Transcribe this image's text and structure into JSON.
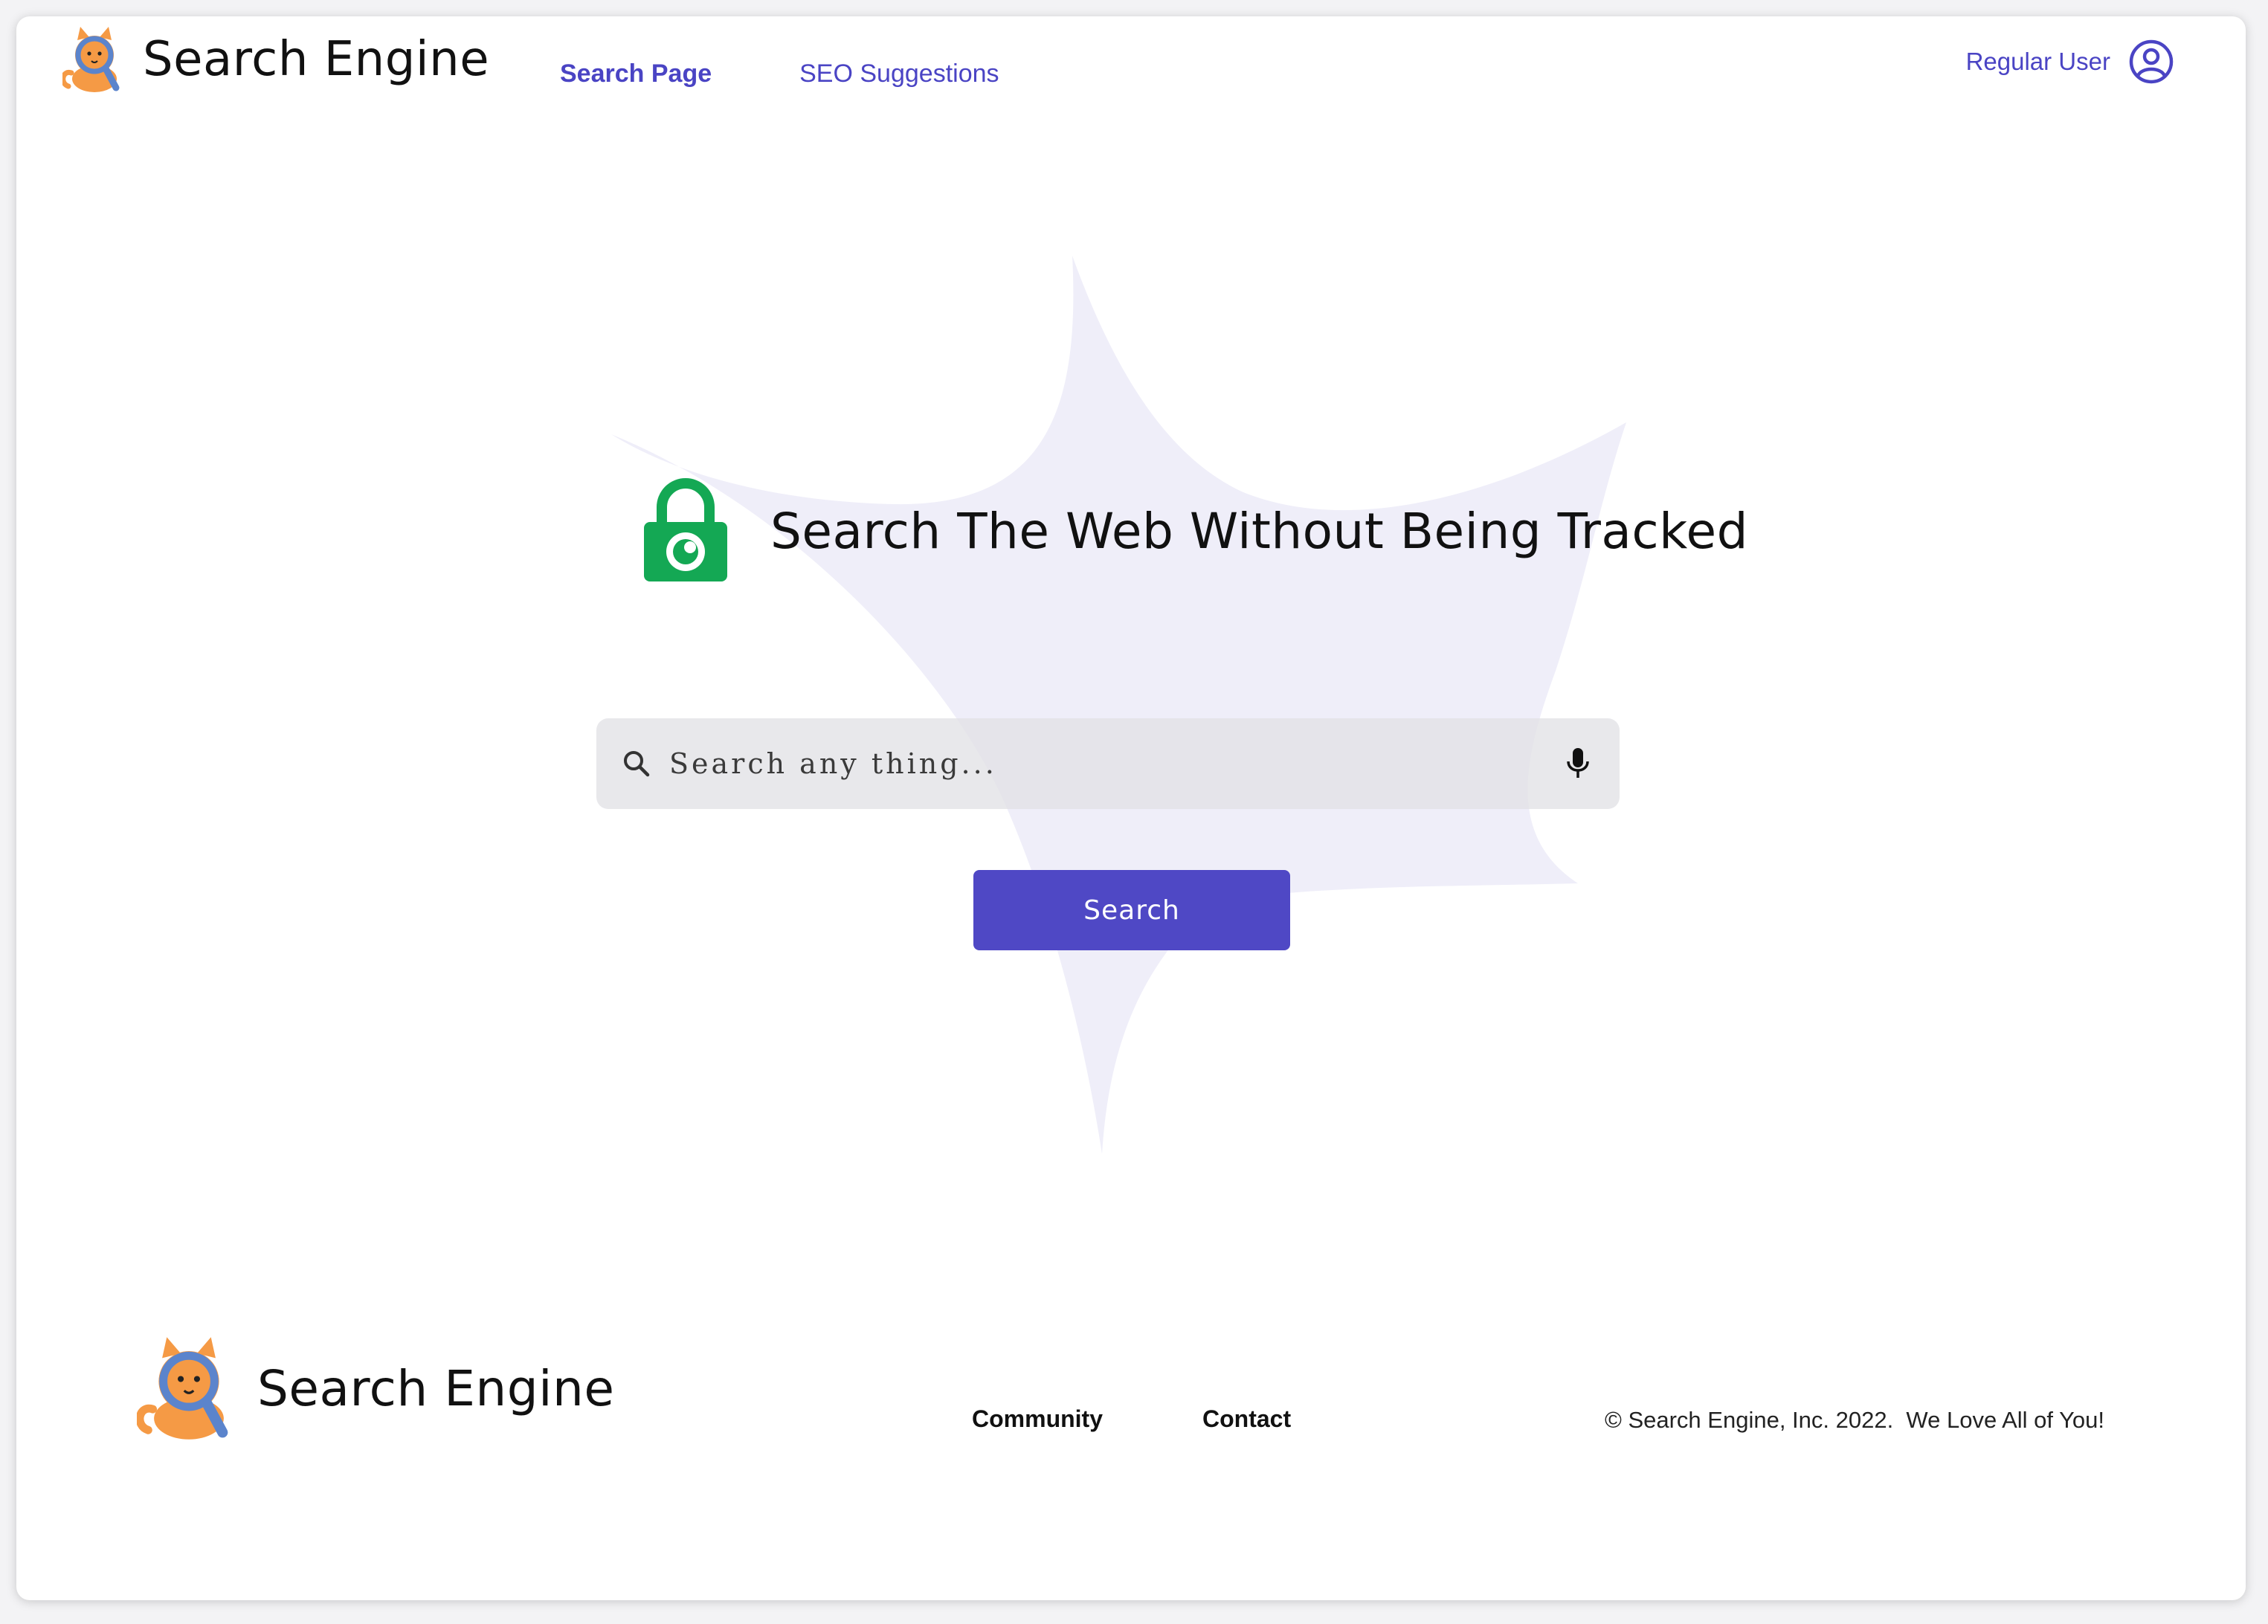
{
  "header": {
    "brand": "Search Engine",
    "nav": [
      {
        "label": "Search Page",
        "active": true
      },
      {
        "label": "SEO Suggestions",
        "active": false
      }
    ],
    "user_label": "Regular User"
  },
  "hero": {
    "title": "Search The Web Without Being Tracked",
    "search_placeholder": "Search any thing...",
    "search_value": "",
    "search_button": "Search"
  },
  "footer": {
    "brand": "Search Engine",
    "links": [
      "Community",
      "Contact"
    ],
    "copyright": "© Search Engine, Inc. 2022.  We Love All of You!"
  },
  "icons": {
    "logo": "cat-mascot-icon",
    "user": "user-circle-icon",
    "lock": "lock-eye-icon",
    "search": "search-icon",
    "mic": "microphone-icon"
  },
  "colors": {
    "accent": "#4f48c5",
    "nav_text": "#4a44c4",
    "lock_green": "#14a854",
    "blob": "#efeef9",
    "search_bg": "#e8e8eb",
    "cat_orange": "#f59a45",
    "cat_blue": "#5b84cc"
  }
}
